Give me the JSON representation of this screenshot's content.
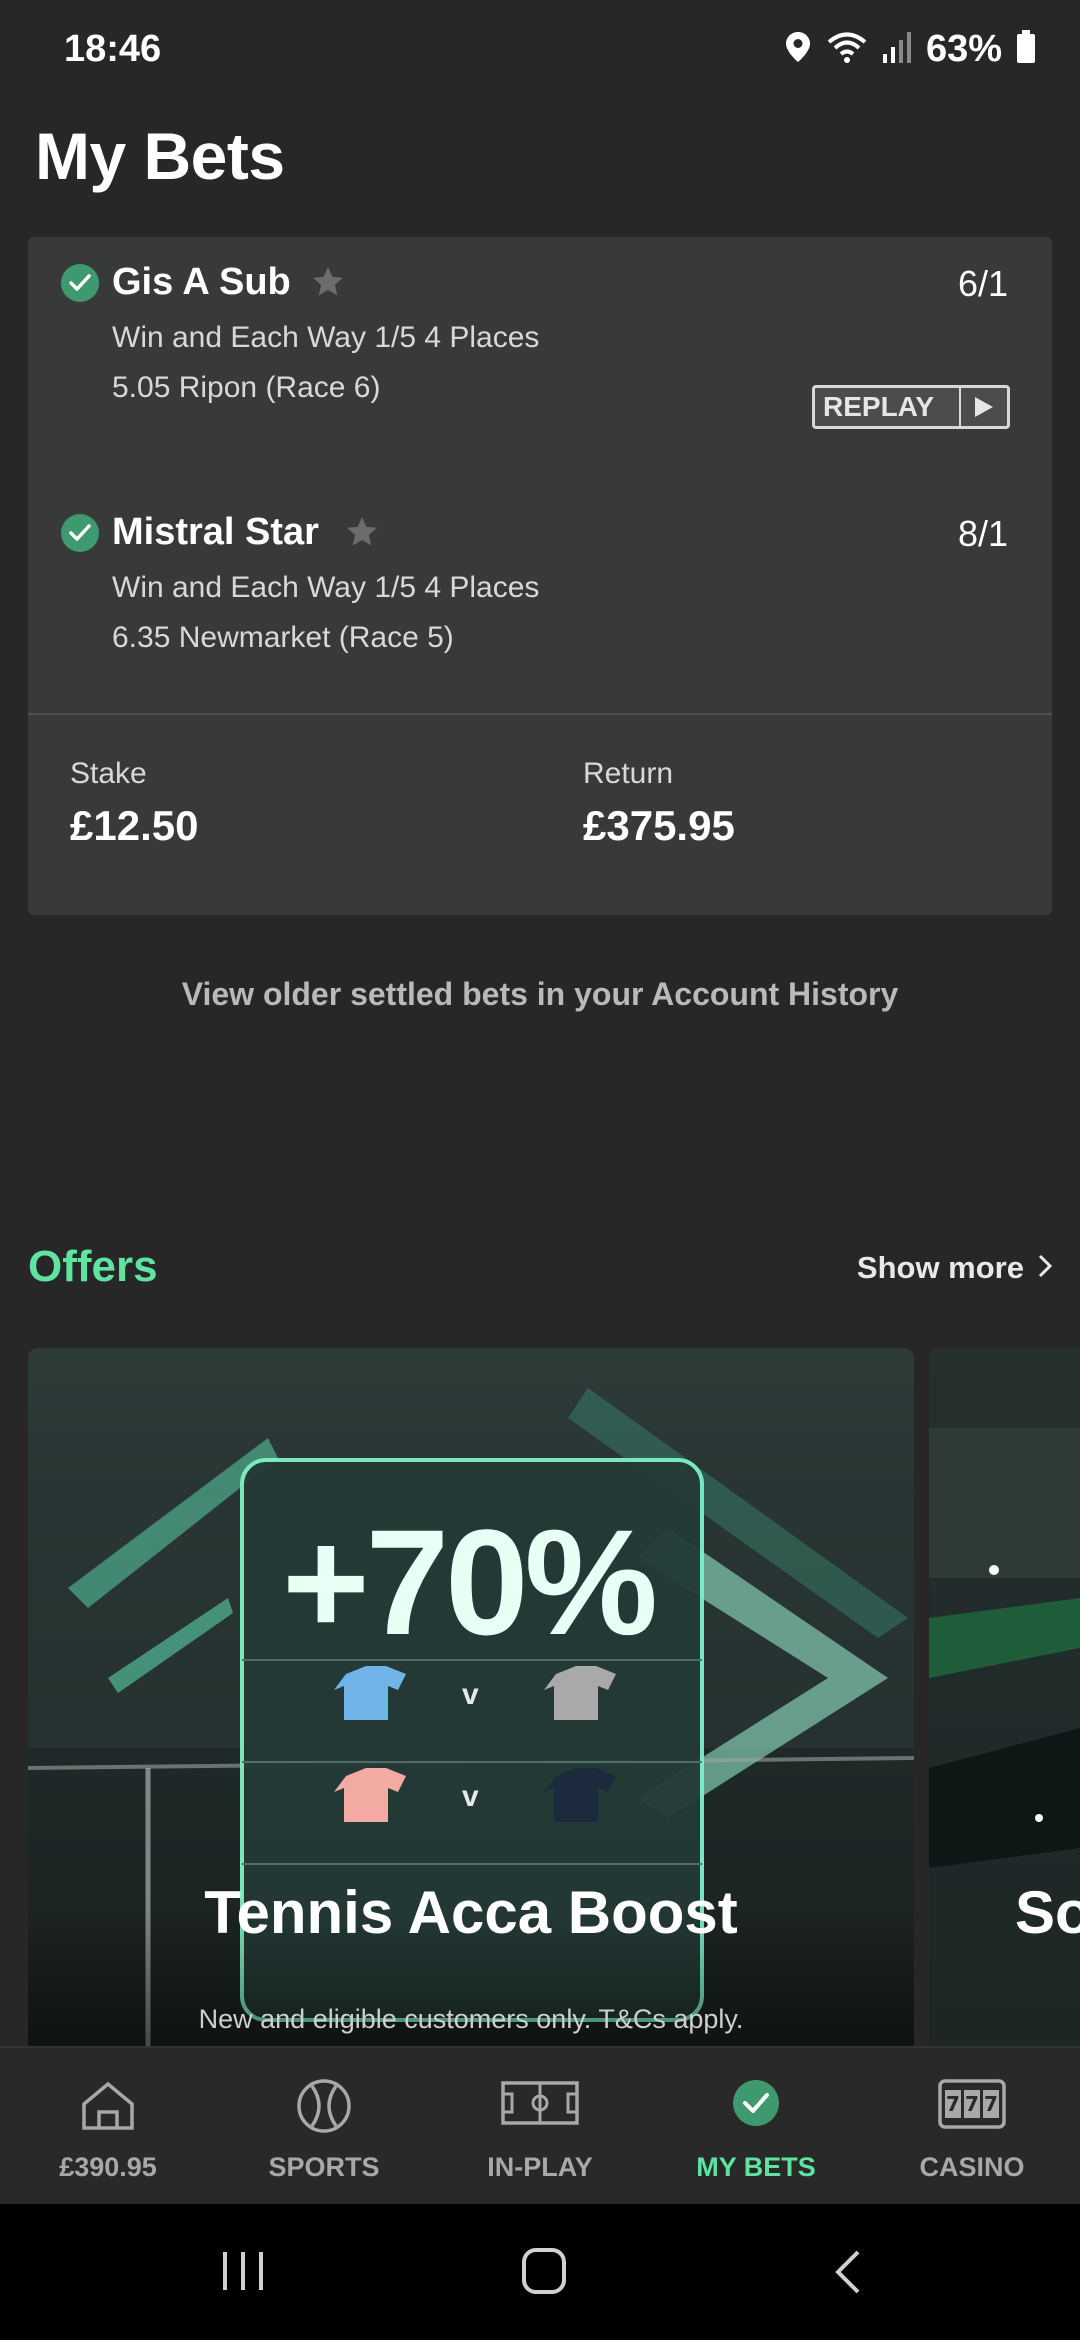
{
  "status_bar": {
    "time": "18:46",
    "battery": "63%",
    "icons": [
      "location-icon",
      "wifi-icon",
      "signal-icon",
      "battery-icon"
    ]
  },
  "header": {
    "title": "My Bets"
  },
  "bet": {
    "selections": [
      {
        "name": "Gis A Sub",
        "odds": "6/1",
        "market": "Win and Each Way 1/5 4 Places",
        "event": "5.05 Ripon (Race 6)",
        "status": "won",
        "replay_label": "REPLAY"
      },
      {
        "name": "Mistral Star",
        "odds": "8/1",
        "market": "Win and Each Way 1/5 4 Places",
        "event": "6.35 Newmarket (Race 5)",
        "status": "won"
      }
    ],
    "stake_label": "Stake",
    "stake": "£12.50",
    "return_label": "Return",
    "return": "£375.95"
  },
  "history_link": "View older settled bets in your Account History",
  "offers": {
    "title": "Offers",
    "show_more": "Show more",
    "cards": [
      {
        "boost": "+70%",
        "title": "Tennis Acca Boost",
        "disclaimer": "New and eligible customers only. T&Cs apply.",
        "vs": [
          "v",
          "v"
        ]
      },
      {
        "title": "So"
      }
    ]
  },
  "bottom_nav": {
    "items": [
      {
        "label": "£390.95",
        "icon": "home-icon",
        "active": false
      },
      {
        "label": "SPORTS",
        "icon": "ball-icon",
        "active": false
      },
      {
        "label": "IN-PLAY",
        "icon": "pitch-icon",
        "active": false
      },
      {
        "label": "MY BETS",
        "icon": "check-circle-icon",
        "active": true
      },
      {
        "label": "CASINO",
        "icon": "slot-machine-icon",
        "active": false
      }
    ]
  },
  "colors": {
    "background": "#272727",
    "card": "#373a39",
    "accent": "#5ee3a1",
    "success": "#3e9a6e"
  }
}
